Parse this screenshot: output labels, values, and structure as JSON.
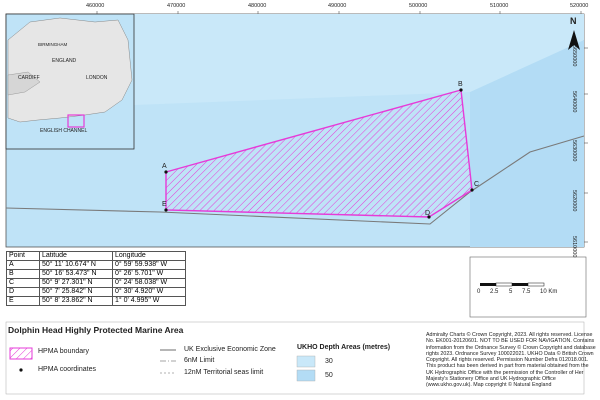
{
  "map": {
    "title": "Dolphin Head Highly Protected Marine Area",
    "colors": {
      "sea": "#bfe3f7",
      "sea_deep": "#a7d4f1",
      "land": "#ececec",
      "hpma": "#e63bd8",
      "eez": "#777777"
    },
    "grid_x_labels": [
      "460000",
      "470000",
      "480000",
      "490000",
      "500000",
      "510000",
      "520000"
    ],
    "grid_y_labels": [
      "5650000",
      "5640000",
      "5630000",
      "5620000",
      "5610000"
    ],
    "north_label": "N",
    "point_labels": [
      "A",
      "B",
      "C",
      "D",
      "E"
    ],
    "inset": {
      "labels": [
        "BIRMINGHAM",
        "LONDON",
        "CARDIFF",
        "ENGLAND",
        "ENGLISH CHANNEL"
      ]
    }
  },
  "coordinates": {
    "headers": [
      "Point",
      "Latitude",
      "Longitude"
    ],
    "rows": [
      {
        "point": "A",
        "lat": "50° 11' 10.674\" N",
        "lon": "0° 59' 59.938\" W"
      },
      {
        "point": "B",
        "lat": "50° 16' 53.473\" N",
        "lon": "0° 26' 5.701\" W"
      },
      {
        "point": "C",
        "lat": "50° 9' 27.301\" N",
        "lon": "0° 24' 58.038\" W"
      },
      {
        "point": "D",
        "lat": "50° 7' 25.842\" N",
        "lon": "0° 30' 4.920\" W"
      },
      {
        "point": "E",
        "lat": "50° 8' 23.862\" N",
        "lon": "1° 0' 4.995\" W"
      }
    ]
  },
  "scale_bar": {
    "ticks": [
      "0",
      "2.5",
      "5",
      "7.5",
      "10 Km"
    ]
  },
  "legend": {
    "hpma_boundary": "HPMA boundary",
    "hpma_coordinates": "HPMA coordinates",
    "eez": "UK Exclusive Economic Zone",
    "six_nm": "6nM Limit",
    "twelve_nm": "12nM Territorial seas limit",
    "depth_title": "UKHO Depth Areas (metres)",
    "depth_30": "30",
    "depth_50": "50"
  },
  "copyright": "Admiralty Charts © Crown Copyright, 2023. All rights reserved. License No. EK001-20120601. NOT TO BE USED FOR NAVIGATION. Contains information from the Ordnance Survey © Crown Copyright and database rights 2023. Ordnance Survey 100022021. UKHO Data © British Crown Copyright. All rights reserved. Permission Number Defra 012018.001. This product has been derived in part from material obtained from the UK Hydrographic Office with the permission of the Controller of Her Majesty's Stationery Office and UK Hydrographic Office (www.ukho.gov.uk). Map copyright © Natural England"
}
